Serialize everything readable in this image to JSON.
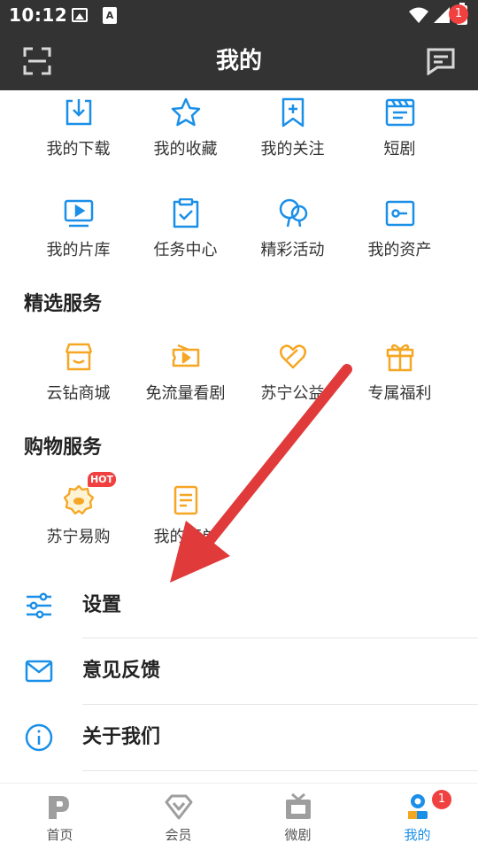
{
  "status_bar": {
    "time": "10:12",
    "icons": [
      "image-icon",
      "a-icon",
      "wifi-icon",
      "signal-icon",
      "battery-charging-icon"
    ]
  },
  "header": {
    "title": "我的",
    "message_badge": "1",
    "left_icon": "scan-icon",
    "right_icon": "message-icon"
  },
  "top_grid": [
    {
      "label": "我的下载",
      "icon": "download-icon"
    },
    {
      "label": "我的收藏",
      "icon": "star-icon"
    },
    {
      "label": "我的关注",
      "icon": "bookmark-plus-icon"
    },
    {
      "label": "短剧",
      "icon": "clapperboard-icon"
    },
    {
      "label": "我的片库",
      "icon": "tv-play-icon"
    },
    {
      "label": "任务中心",
      "icon": "clipboard-check-icon"
    },
    {
      "label": "精彩活动",
      "icon": "balloon-icon"
    },
    {
      "label": "我的资产",
      "icon": "wallet-card-icon"
    }
  ],
  "featured_services": {
    "title": "精选服务",
    "items": [
      {
        "label": "云钻商城",
        "icon": "store-icon"
      },
      {
        "label": "免流量看剧",
        "icon": "ticket-play-icon"
      },
      {
        "label": "苏宁公益",
        "icon": "heart-hands-icon"
      },
      {
        "label": "专属福利",
        "icon": "gift-icon"
      }
    ]
  },
  "shopping_services": {
    "title": "购物服务",
    "items": [
      {
        "label": "苏宁易购",
        "icon": "suning-lion-icon",
        "badge": "HOT"
      },
      {
        "label": "我的订单",
        "icon": "order-document-icon"
      }
    ]
  },
  "menu": [
    {
      "label": "设置",
      "icon": "settings-sliders-icon"
    },
    {
      "label": "意见反馈",
      "icon": "mail-icon"
    },
    {
      "label": "关于我们",
      "icon": "info-icon"
    }
  ],
  "bottom_nav": {
    "active_index": 3,
    "items": [
      {
        "label": "首页",
        "icon": "home-p-icon"
      },
      {
        "label": "会员",
        "icon": "diamond-icon"
      },
      {
        "label": "微剧",
        "icon": "tv-icon"
      },
      {
        "label": "我的",
        "icon": "profile-icon",
        "badge": "1"
      }
    ]
  },
  "colors": {
    "header_bg": "#333333",
    "grid_icon_blue": "#1a8fe8",
    "service_icon_orange": "#f5a623",
    "badge_red": "#f04040",
    "annotation_arrow": "#e03a3a"
  }
}
